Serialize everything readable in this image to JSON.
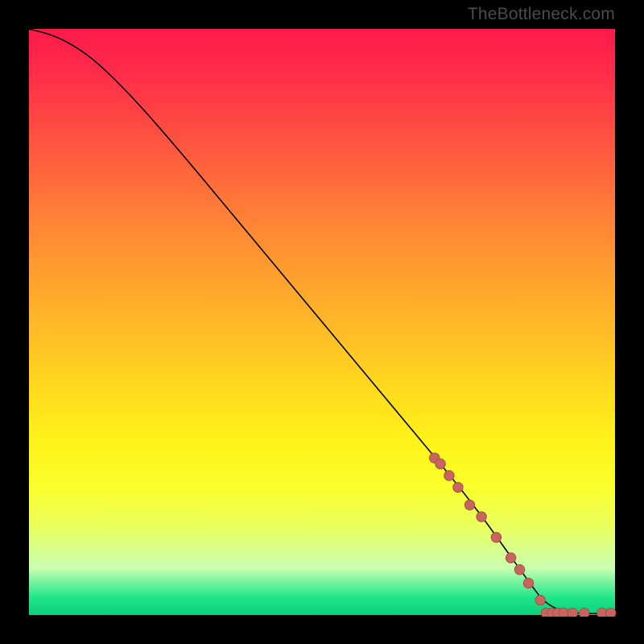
{
  "watermark": "TheBottleneck.com",
  "colors": {
    "frame_bg": "#000000",
    "curve": "#000000",
    "dot_fill": "#c7665e",
    "dot_stroke": "#a94e47"
  },
  "chart_data": {
    "type": "line",
    "title": "",
    "xlabel": "",
    "ylabel": "",
    "xlim": [
      0,
      100
    ],
    "ylim": [
      0,
      100
    ],
    "curve": {
      "x": [
        0,
        4,
        8,
        12,
        18,
        25,
        35,
        45,
        55,
        65,
        75,
        85,
        88,
        92,
        96,
        100
      ],
      "y": [
        100,
        99,
        97,
        94,
        88,
        80,
        68,
        56,
        44,
        32,
        20,
        6,
        2,
        0.6,
        0.5,
        0.5
      ]
    },
    "series": [
      {
        "name": "points-on-slope",
        "x": [
          69,
          70,
          71.5,
          73,
          75,
          77,
          79.5,
          82,
          83.5,
          85,
          87
        ],
        "y": [
          27,
          26,
          24,
          22,
          19,
          17,
          13.5,
          10,
          8,
          5.7,
          2.8
        ]
      },
      {
        "name": "points-on-floor",
        "x": [
          88,
          89,
          90,
          91,
          92.5,
          94.5,
          97.5,
          99
        ],
        "y": [
          0.6,
          0.6,
          0.6,
          0.6,
          0.6,
          0.6,
          0.6,
          0.6
        ]
      }
    ]
  }
}
